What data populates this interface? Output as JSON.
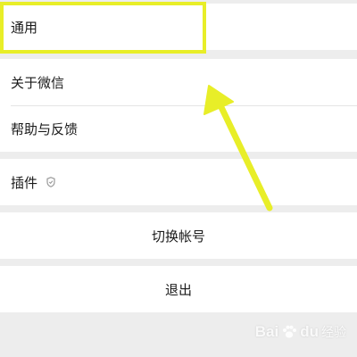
{
  "settings": {
    "general": "通用",
    "about": "关于微信",
    "help_feedback": "帮助与反馈",
    "plugins": "插件",
    "switch_account": "切换帐号",
    "logout": "退出"
  },
  "annotation": {
    "highlight_color": "#e8ee28",
    "arrow_color": "#e8ee28"
  },
  "watermark": {
    "brand": "Bai",
    "brand2": "du",
    "suffix": "经验"
  },
  "icons": {
    "plugin_badge": "shield-icon"
  }
}
